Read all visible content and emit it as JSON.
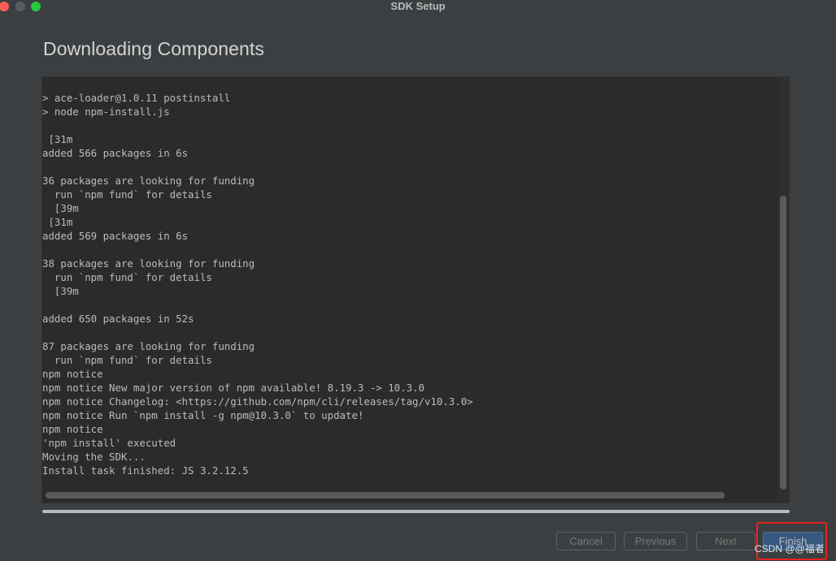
{
  "window": {
    "title": "SDK Setup"
  },
  "page": {
    "heading": "Downloading Components"
  },
  "log": {
    "lines": [
      "> ace-loader@1.0.11 postinstall",
      "> node npm-install.js",
      "",
      " [31m",
      "added 566 packages in 6s",
      "",
      "36 packages are looking for funding",
      "  run `npm fund` for details",
      "  [39m",
      " [31m",
      "added 569 packages in 6s",
      "",
      "38 packages are looking for funding",
      "  run `npm fund` for details",
      "  [39m",
      "",
      "added 650 packages in 52s",
      "",
      "87 packages are looking for funding",
      "  run `npm fund` for details",
      "npm notice",
      "npm notice New major version of npm available! 8.19.3 -> 10.3.0",
      "npm notice Changelog: <https://github.com/npm/cli/releases/tag/v10.3.0>",
      "npm notice Run `npm install -g npm@10.3.0` to update!",
      "npm notice",
      "'npm install' executed",
      "Moving the SDK...",
      "Install task finished: JS 3.2.12.5"
    ]
  },
  "progress": {
    "value_percent": 100
  },
  "buttons": {
    "cancel": "Cancel",
    "previous": "Previous",
    "next": "Next",
    "finish": "Finish"
  },
  "watermark": "CSDN @@福者",
  "colors": {
    "background": "#3c3f41",
    "log_background": "#2b2b2b",
    "primary_button": "#365880",
    "highlight": "#e8241c"
  }
}
